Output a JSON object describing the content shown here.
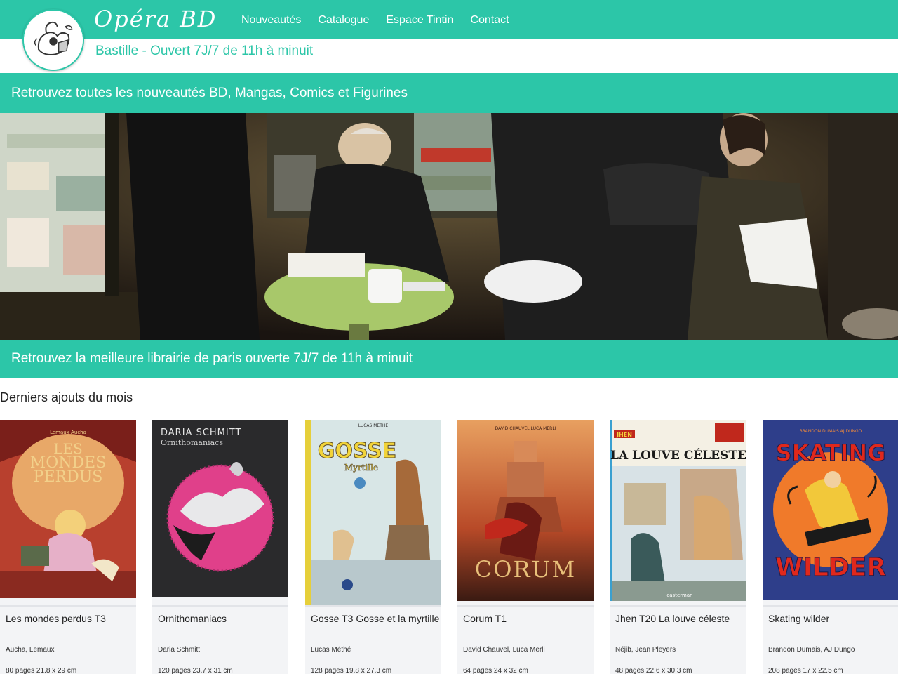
{
  "header": {
    "brand": "Opéra BD",
    "tagline": "Bastille - Ouvert 7J/7 de 11h à minuit",
    "nav": [
      "Nouveautés",
      "Catalogue",
      "Espace Tintin",
      "Contact"
    ]
  },
  "banner_top": "Retrouvez toutes les nouveautés BD, Mangas, Comics et Figurines",
  "banner_bottom": "Retrouvez la meilleure librairie de paris ouverte 7J/7 de 11h à minuit",
  "section_title": "Derniers ajouts du mois",
  "colors": {
    "accent": "#2cc6a8",
    "card_bg": "#f3f4f6"
  },
  "books": [
    {
      "title": "Les mondes perdus T3",
      "authors": "Aucha, Lemaux",
      "format": "80 pages 21.8 x 29 cm"
    },
    {
      "title": "Ornithomaniacs",
      "authors": "Daria Schmitt",
      "format": "120 pages 23.7 x 31 cm"
    },
    {
      "title": "Gosse T3 Gosse et la myrtille",
      "authors": "Lucas Méthé",
      "format": "128 pages 19.8 x 27.3 cm"
    },
    {
      "title": "Corum T1",
      "authors": "David Chauvel, Luca Merli",
      "format": "64 pages 24 x 32 cm"
    },
    {
      "title": "Jhen T20 La louve céleste",
      "authors": "Néjib, Jean Pleyers",
      "format": "48 pages 22.6 x 30.3 cm"
    },
    {
      "title": "Skating wilder",
      "authors": "Brandon Dumais, AJ Dungo",
      "format": "208 pages 17 x 22.5 cm"
    }
  ],
  "covers": [
    {
      "lettering": [
        "LES",
        "MONDES",
        "PERDUS"
      ],
      "byline": "Lemaux  Aucha"
    },
    {
      "lettering": [
        "DARIA SCHMITT",
        "Ornithomaniacs"
      ],
      "byline": ""
    },
    {
      "lettering": [
        "GOSSE",
        "Myrtille"
      ],
      "byline": "LUCAS MÉTHÉ"
    },
    {
      "lettering": [
        "CORUM"
      ],
      "byline": "DAVID CHAUVEL    LUCA MERLI"
    },
    {
      "lettering": [
        "JHEN",
        "LA LOUVE CÉLESTE"
      ],
      "byline": "casterman"
    },
    {
      "lettering": [
        "SKATING",
        "WILDER"
      ],
      "byline": "BRANDON DUMAIS   AJ DUNGO"
    }
  ]
}
